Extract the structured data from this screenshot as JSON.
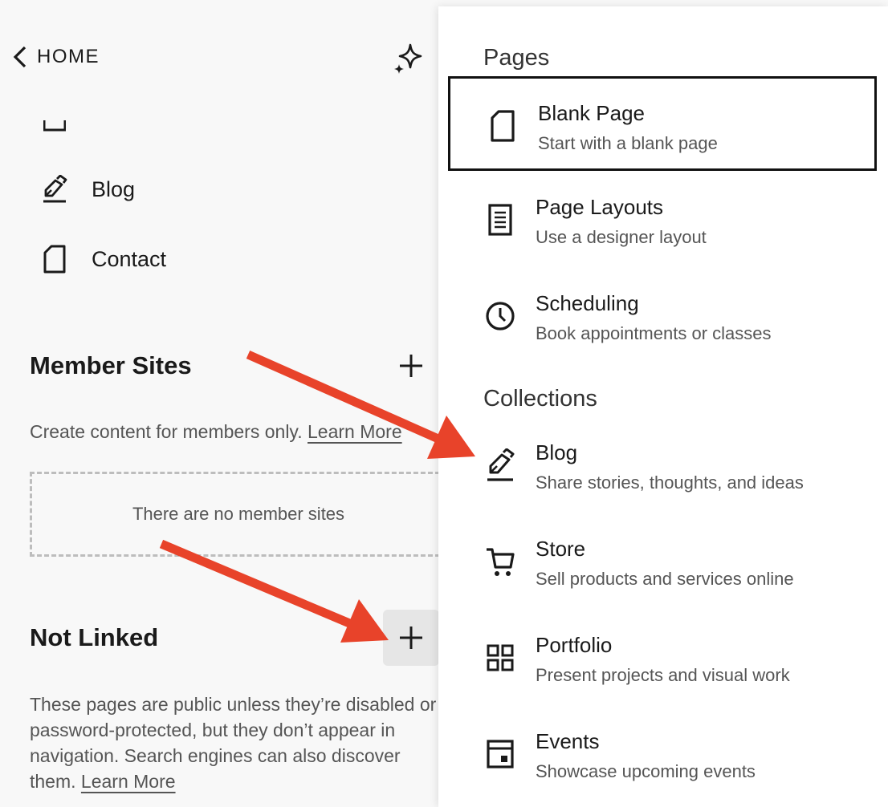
{
  "sidebar": {
    "home_label": "HOME",
    "nav_items": [
      {
        "label": "Blog",
        "icon": "pen-icon"
      },
      {
        "label": "Contact",
        "icon": "page-icon"
      }
    ],
    "member_sites": {
      "title": "Member Sites",
      "description": "Create content for members only.",
      "learn_more": "Learn More",
      "empty_text": "There are no member sites"
    },
    "not_linked": {
      "title": "Not Linked",
      "description_lines": [
        "These pages are public unless they’re disabled or",
        "password-protected, but they don’t appear in",
        "navigation. Search engines can also discover",
        "them."
      ],
      "learn_more": "Learn More"
    }
  },
  "menu": {
    "pages_heading": "Pages",
    "collections_heading": "Collections",
    "pages": [
      {
        "title": "Blank Page",
        "subtitle": "Start with a blank page",
        "icon": "blank-page-icon"
      },
      {
        "title": "Page Layouts",
        "subtitle": "Use a designer layout",
        "icon": "layout-icon"
      },
      {
        "title": "Scheduling",
        "subtitle": "Book appointments or classes",
        "icon": "clock-icon"
      }
    ],
    "collections": [
      {
        "title": "Blog",
        "subtitle": "Share stories, thoughts, and ideas",
        "icon": "pen-icon"
      },
      {
        "title": "Store",
        "subtitle": "Sell products and services online",
        "icon": "cart-icon"
      },
      {
        "title": "Portfolio",
        "subtitle": "Present projects and visual work",
        "icon": "grid-icon"
      },
      {
        "title": "Events",
        "subtitle": "Showcase upcoming events",
        "icon": "calendar-icon"
      }
    ]
  },
  "colors": {
    "annotation_arrow": "#e8432a",
    "selected_border": "#111111",
    "hover_background": "#e6e6e6"
  }
}
